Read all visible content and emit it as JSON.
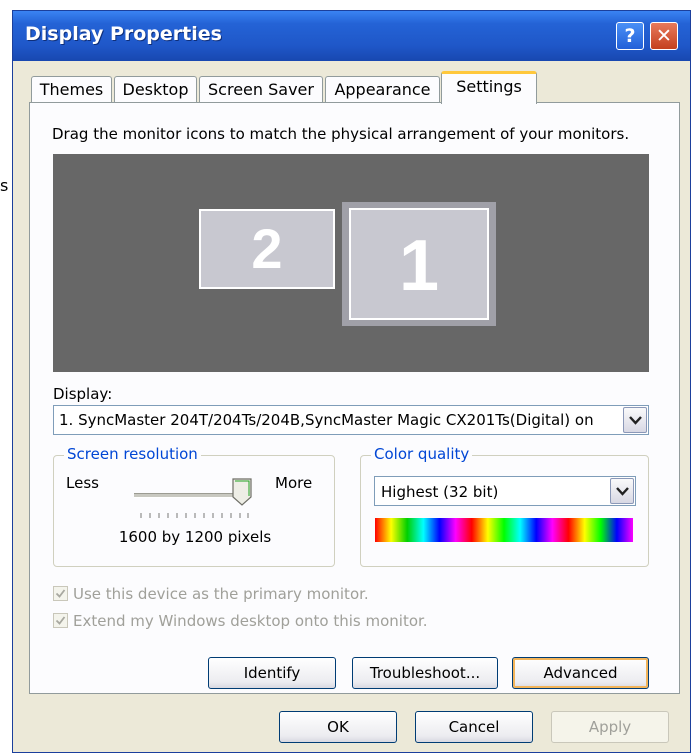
{
  "stray_text": "s",
  "window": {
    "title": "Display Properties",
    "help_label": "?",
    "close_label": "✕"
  },
  "tabs": [
    {
      "label": "Themes",
      "active": false
    },
    {
      "label": "Desktop",
      "active": false
    },
    {
      "label": "Screen Saver",
      "active": false
    },
    {
      "label": "Appearance",
      "active": false
    },
    {
      "label": "Settings",
      "active": true
    }
  ],
  "settings": {
    "instruction": "Drag the monitor icons to match the physical arrangement of your monitors.",
    "monitors": [
      {
        "number": "1"
      },
      {
        "number": "2"
      }
    ],
    "display_label": "Display:",
    "display_value": "1. SyncMaster 204T/204Ts/204B,SyncMaster Magic CX201Ts(Digital) on",
    "screen_resolution": {
      "legend": "Screen resolution",
      "less_label": "Less",
      "more_label": "More",
      "value_text": "1600 by 1200 pixels",
      "slider_fraction": 0.92
    },
    "color_quality": {
      "legend": "Color quality",
      "value": "Highest (32 bit)"
    },
    "checkboxes": [
      {
        "label": "Use this device as the primary monitor.",
        "checked": true,
        "enabled": false
      },
      {
        "label": "Extend my Windows desktop onto this monitor.",
        "checked": true,
        "enabled": false
      }
    ],
    "buttons": {
      "identify": "Identify",
      "troubleshoot": "Troubleshoot...",
      "advanced": "Advanced"
    }
  },
  "dialog_buttons": {
    "ok": "OK",
    "cancel": "Cancel",
    "apply": "Apply"
  },
  "colors": {
    "accent": "#0046d5",
    "titlebar": "#2463d6",
    "monitor_bg": "#676767"
  }
}
